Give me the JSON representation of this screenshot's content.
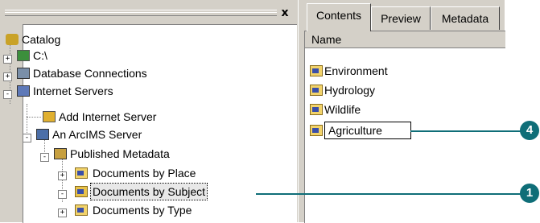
{
  "catalog_tree": {
    "close_glyph": "x",
    "nodes": [
      {
        "label": "Catalog",
        "icon": "catalog-icon",
        "expander": ""
      },
      {
        "label": "C:\\",
        "icon": "drive-icon",
        "expander": "+"
      },
      {
        "label": "Database Connections",
        "icon": "database-connections-icon",
        "expander": "+"
      },
      {
        "label": "Internet Servers",
        "icon": "internet-servers-icon",
        "expander": "-"
      },
      {
        "label": "Add Internet Server",
        "icon": "add-server-icon",
        "expander": ""
      },
      {
        "label": "An ArcIMS Server",
        "icon": "arcims-server-icon",
        "expander": "-"
      },
      {
        "label": "Published Metadata",
        "icon": "published-metadata-icon",
        "expander": "-"
      },
      {
        "label": "Documents by Place",
        "icon": "folder-icon",
        "expander": "+"
      },
      {
        "label": "Documents by Subject",
        "icon": "open-folder-icon",
        "expander": "-",
        "selected": true
      },
      {
        "label": "Documents by Type",
        "icon": "folder-icon",
        "expander": "+"
      }
    ]
  },
  "tabs": [
    {
      "label": "Contents",
      "active": true
    },
    {
      "label": "Preview",
      "active": false
    },
    {
      "label": "Metadata",
      "active": false
    }
  ],
  "contents_list": {
    "column_header": "Name",
    "items": [
      {
        "label": "Environment",
        "icon": "folder-icon"
      },
      {
        "label": "Hydrology",
        "icon": "folder-icon"
      },
      {
        "label": "Wildlife",
        "icon": "folder-icon"
      },
      {
        "label": "Agriculture",
        "icon": "folder-icon",
        "editing": true
      }
    ]
  },
  "callouts": [
    {
      "number": "4",
      "target": "Agriculture"
    },
    {
      "number": "1",
      "target": "Documents by Subject"
    }
  ],
  "colors": {
    "callout": "#0f6e78",
    "window": "#d4d0c8",
    "folder": "#f2d36a"
  }
}
